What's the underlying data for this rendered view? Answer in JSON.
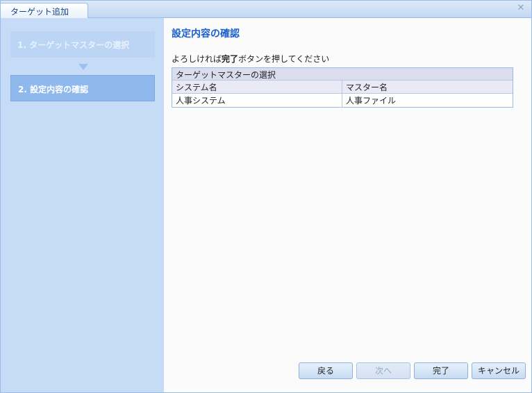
{
  "window": {
    "title": "ターゲット追加"
  },
  "wizard": {
    "steps": [
      {
        "label": "1. ターゲットマスターの選択",
        "state": "done"
      },
      {
        "label": "2. 設定内容の確認",
        "state": "active"
      }
    ]
  },
  "content": {
    "title": "設定内容の確認",
    "instruction_pre": "よろしければ",
    "instruction_bold": "完了",
    "instruction_post": "ボタンを押してください",
    "summary": {
      "section": "ターゲットマスターの選択",
      "columns": [
        "システム名",
        "マスター名"
      ],
      "rows": [
        [
          "人事システム",
          "人事ファイル"
        ]
      ]
    }
  },
  "buttons": {
    "back": "戻る",
    "next": "次へ",
    "finish": "完了",
    "cancel": "キャンセル"
  },
  "icons": {
    "close": "close-icon",
    "step_arrow": "step-arrow-down-icon"
  },
  "colors": {
    "accent": "#1a5fcc",
    "active_step": "#8fb8ec",
    "sidebar": "#c6dcf6"
  }
}
